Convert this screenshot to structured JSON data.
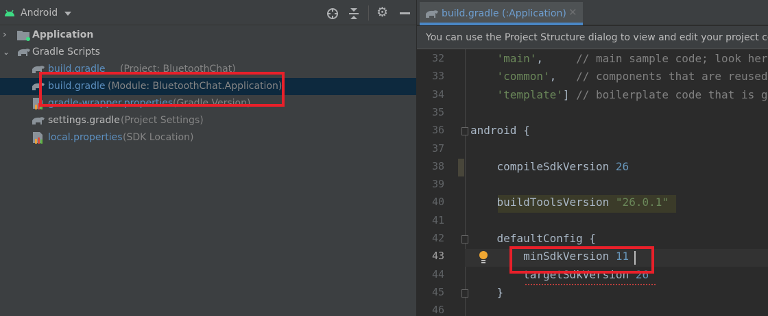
{
  "project_panel": {
    "view_selector": "Android",
    "toolbar_icons": [
      "locate-icon",
      "collapse-all-icon",
      "gear-icon",
      "minimize-icon"
    ],
    "tree": [
      {
        "label": "Application",
        "hint": "",
        "level": 0,
        "expanded": false,
        "icon": "module-folder-icon"
      },
      {
        "label": "Gradle Scripts",
        "hint": "",
        "level": 0,
        "expanded": true,
        "icon": "gradle-elephant-icon"
      },
      {
        "label": "build.gradle",
        "hint": "(Project: BluetoothChat)",
        "level": 1,
        "icon": "gradle-elephant-icon"
      },
      {
        "label": "build.gradle",
        "hint": "(Module: BluetoothChat.Application)",
        "level": 1,
        "icon": "gradle-elephant-icon",
        "selected": true
      },
      {
        "label": "gradle-wrapper.properties",
        "hint": "(Gradle Version)",
        "level": 1,
        "icon": "properties-file-icon"
      },
      {
        "label": "settings.gradle",
        "hint": "(Project Settings)",
        "level": 1,
        "icon": "gradle-elephant-icon"
      },
      {
        "label": "local.properties",
        "hint": "(SDK Location)",
        "level": 1,
        "icon": "properties-file-icon"
      }
    ]
  },
  "editor": {
    "tab": "build.gradle (:Application)",
    "banner": "You can use the Project Structure dialog to view and edit your project configuration",
    "lines": [
      {
        "n": "32",
        "parts": [
          [
            "str",
            "    'main'"
          ],
          [
            "",
            ","
          ],
          [
            "cm",
            "     // main sample code; look here for the interesting stuff"
          ]
        ]
      },
      {
        "n": "33",
        "parts": [
          [
            "str",
            "    'common'"
          ],
          [
            "",
            ","
          ],
          [
            "cm",
            "   // components that are reused by multiple samples"
          ]
        ]
      },
      {
        "n": "34",
        "parts": [
          [
            "str",
            "    'template'"
          ],
          [
            "",
            "] "
          ],
          [
            "cm",
            "// boilerplate code that is generated"
          ]
        ]
      },
      {
        "n": "35",
        "parts": []
      },
      {
        "n": "36",
        "parts": [
          [
            "",
            "android {"
          ]
        ]
      },
      {
        "n": "37",
        "parts": []
      },
      {
        "n": "38",
        "parts": [
          [
            "",
            "    compileSdkVersion "
          ],
          [
            "num",
            "26"
          ]
        ]
      },
      {
        "n": "39",
        "parts": []
      },
      {
        "n": "40",
        "parts": [
          [
            "",
            "    buildToolsVersion "
          ],
          [
            "str",
            "\"26.0.1\""
          ]
        ]
      },
      {
        "n": "41",
        "parts": []
      },
      {
        "n": "42",
        "parts": [
          [
            "",
            "    defaultConfig {"
          ]
        ]
      },
      {
        "n": "43",
        "parts": [
          [
            "",
            "        minSdkVersion "
          ],
          [
            "num",
            "11"
          ]
        ]
      },
      {
        "n": "44",
        "parts": [
          [
            "",
            "        targetSdkVersion "
          ],
          [
            "num",
            "26"
          ]
        ]
      },
      {
        "n": "45",
        "parts": [
          [
            "",
            "    }"
          ]
        ]
      },
      {
        "n": "46",
        "parts": []
      }
    ]
  },
  "colors": {
    "highlight_box": "#e8202a",
    "selection": "#0d293e",
    "accent": "#4a88c7"
  }
}
